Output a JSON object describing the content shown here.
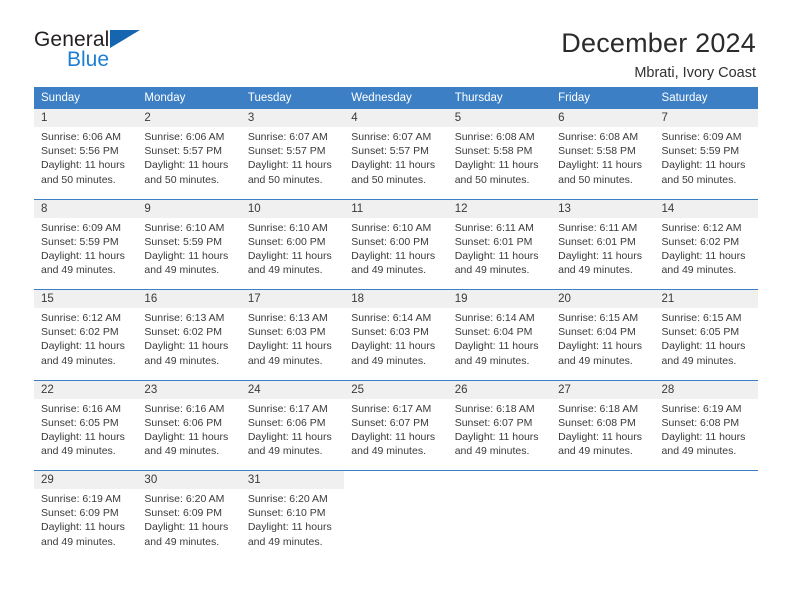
{
  "brand": {
    "line1": "General",
    "line2": "Blue",
    "logo_color": "#1565b0",
    "accent_color": "#1d7fd4"
  },
  "header": {
    "title": "December 2024",
    "subtitle": "Mbrati, Ivory Coast"
  },
  "theme": {
    "header_row_bg": "#3c7fc4",
    "daynum_bg": "#f0f0f0",
    "text_color": "#3a3a3a"
  },
  "weekdays": [
    "Sunday",
    "Monday",
    "Tuesday",
    "Wednesday",
    "Thursday",
    "Friday",
    "Saturday"
  ],
  "weeks": [
    [
      {
        "day": "1",
        "sunrise": "Sunrise: 6:06 AM",
        "sunset": "Sunset: 5:56 PM",
        "daylight1": "Daylight: 11 hours",
        "daylight2": "and 50 minutes."
      },
      {
        "day": "2",
        "sunrise": "Sunrise: 6:06 AM",
        "sunset": "Sunset: 5:57 PM",
        "daylight1": "Daylight: 11 hours",
        "daylight2": "and 50 minutes."
      },
      {
        "day": "3",
        "sunrise": "Sunrise: 6:07 AM",
        "sunset": "Sunset: 5:57 PM",
        "daylight1": "Daylight: 11 hours",
        "daylight2": "and 50 minutes."
      },
      {
        "day": "4",
        "sunrise": "Sunrise: 6:07 AM",
        "sunset": "Sunset: 5:57 PM",
        "daylight1": "Daylight: 11 hours",
        "daylight2": "and 50 minutes."
      },
      {
        "day": "5",
        "sunrise": "Sunrise: 6:08 AM",
        "sunset": "Sunset: 5:58 PM",
        "daylight1": "Daylight: 11 hours",
        "daylight2": "and 50 minutes."
      },
      {
        "day": "6",
        "sunrise": "Sunrise: 6:08 AM",
        "sunset": "Sunset: 5:58 PM",
        "daylight1": "Daylight: 11 hours",
        "daylight2": "and 50 minutes."
      },
      {
        "day": "7",
        "sunrise": "Sunrise: 6:09 AM",
        "sunset": "Sunset: 5:59 PM",
        "daylight1": "Daylight: 11 hours",
        "daylight2": "and 50 minutes."
      }
    ],
    [
      {
        "day": "8",
        "sunrise": "Sunrise: 6:09 AM",
        "sunset": "Sunset: 5:59 PM",
        "daylight1": "Daylight: 11 hours",
        "daylight2": "and 49 minutes."
      },
      {
        "day": "9",
        "sunrise": "Sunrise: 6:10 AM",
        "sunset": "Sunset: 5:59 PM",
        "daylight1": "Daylight: 11 hours",
        "daylight2": "and 49 minutes."
      },
      {
        "day": "10",
        "sunrise": "Sunrise: 6:10 AM",
        "sunset": "Sunset: 6:00 PM",
        "daylight1": "Daylight: 11 hours",
        "daylight2": "and 49 minutes."
      },
      {
        "day": "11",
        "sunrise": "Sunrise: 6:10 AM",
        "sunset": "Sunset: 6:00 PM",
        "daylight1": "Daylight: 11 hours",
        "daylight2": "and 49 minutes."
      },
      {
        "day": "12",
        "sunrise": "Sunrise: 6:11 AM",
        "sunset": "Sunset: 6:01 PM",
        "daylight1": "Daylight: 11 hours",
        "daylight2": "and 49 minutes."
      },
      {
        "day": "13",
        "sunrise": "Sunrise: 6:11 AM",
        "sunset": "Sunset: 6:01 PM",
        "daylight1": "Daylight: 11 hours",
        "daylight2": "and 49 minutes."
      },
      {
        "day": "14",
        "sunrise": "Sunrise: 6:12 AM",
        "sunset": "Sunset: 6:02 PM",
        "daylight1": "Daylight: 11 hours",
        "daylight2": "and 49 minutes."
      }
    ],
    [
      {
        "day": "15",
        "sunrise": "Sunrise: 6:12 AM",
        "sunset": "Sunset: 6:02 PM",
        "daylight1": "Daylight: 11 hours",
        "daylight2": "and 49 minutes."
      },
      {
        "day": "16",
        "sunrise": "Sunrise: 6:13 AM",
        "sunset": "Sunset: 6:02 PM",
        "daylight1": "Daylight: 11 hours",
        "daylight2": "and 49 minutes."
      },
      {
        "day": "17",
        "sunrise": "Sunrise: 6:13 AM",
        "sunset": "Sunset: 6:03 PM",
        "daylight1": "Daylight: 11 hours",
        "daylight2": "and 49 minutes."
      },
      {
        "day": "18",
        "sunrise": "Sunrise: 6:14 AM",
        "sunset": "Sunset: 6:03 PM",
        "daylight1": "Daylight: 11 hours",
        "daylight2": "and 49 minutes."
      },
      {
        "day": "19",
        "sunrise": "Sunrise: 6:14 AM",
        "sunset": "Sunset: 6:04 PM",
        "daylight1": "Daylight: 11 hours",
        "daylight2": "and 49 minutes."
      },
      {
        "day": "20",
        "sunrise": "Sunrise: 6:15 AM",
        "sunset": "Sunset: 6:04 PM",
        "daylight1": "Daylight: 11 hours",
        "daylight2": "and 49 minutes."
      },
      {
        "day": "21",
        "sunrise": "Sunrise: 6:15 AM",
        "sunset": "Sunset: 6:05 PM",
        "daylight1": "Daylight: 11 hours",
        "daylight2": "and 49 minutes."
      }
    ],
    [
      {
        "day": "22",
        "sunrise": "Sunrise: 6:16 AM",
        "sunset": "Sunset: 6:05 PM",
        "daylight1": "Daylight: 11 hours",
        "daylight2": "and 49 minutes."
      },
      {
        "day": "23",
        "sunrise": "Sunrise: 6:16 AM",
        "sunset": "Sunset: 6:06 PM",
        "daylight1": "Daylight: 11 hours",
        "daylight2": "and 49 minutes."
      },
      {
        "day": "24",
        "sunrise": "Sunrise: 6:17 AM",
        "sunset": "Sunset: 6:06 PM",
        "daylight1": "Daylight: 11 hours",
        "daylight2": "and 49 minutes."
      },
      {
        "day": "25",
        "sunrise": "Sunrise: 6:17 AM",
        "sunset": "Sunset: 6:07 PM",
        "daylight1": "Daylight: 11 hours",
        "daylight2": "and 49 minutes."
      },
      {
        "day": "26",
        "sunrise": "Sunrise: 6:18 AM",
        "sunset": "Sunset: 6:07 PM",
        "daylight1": "Daylight: 11 hours",
        "daylight2": "and 49 minutes."
      },
      {
        "day": "27",
        "sunrise": "Sunrise: 6:18 AM",
        "sunset": "Sunset: 6:08 PM",
        "daylight1": "Daylight: 11 hours",
        "daylight2": "and 49 minutes."
      },
      {
        "day": "28",
        "sunrise": "Sunrise: 6:19 AM",
        "sunset": "Sunset: 6:08 PM",
        "daylight1": "Daylight: 11 hours",
        "daylight2": "and 49 minutes."
      }
    ],
    [
      {
        "day": "29",
        "sunrise": "Sunrise: 6:19 AM",
        "sunset": "Sunset: 6:09 PM",
        "daylight1": "Daylight: 11 hours",
        "daylight2": "and 49 minutes."
      },
      {
        "day": "30",
        "sunrise": "Sunrise: 6:20 AM",
        "sunset": "Sunset: 6:09 PM",
        "daylight1": "Daylight: 11 hours",
        "daylight2": "and 49 minutes."
      },
      {
        "day": "31",
        "sunrise": "Sunrise: 6:20 AM",
        "sunset": "Sunset: 6:10 PM",
        "daylight1": "Daylight: 11 hours",
        "daylight2": "and 49 minutes."
      },
      {
        "day": "",
        "sunrise": "",
        "sunset": "",
        "daylight1": "",
        "daylight2": ""
      },
      {
        "day": "",
        "sunrise": "",
        "sunset": "",
        "daylight1": "",
        "daylight2": ""
      },
      {
        "day": "",
        "sunrise": "",
        "sunset": "",
        "daylight1": "",
        "daylight2": ""
      },
      {
        "day": "",
        "sunrise": "",
        "sunset": "",
        "daylight1": "",
        "daylight2": ""
      }
    ]
  ]
}
